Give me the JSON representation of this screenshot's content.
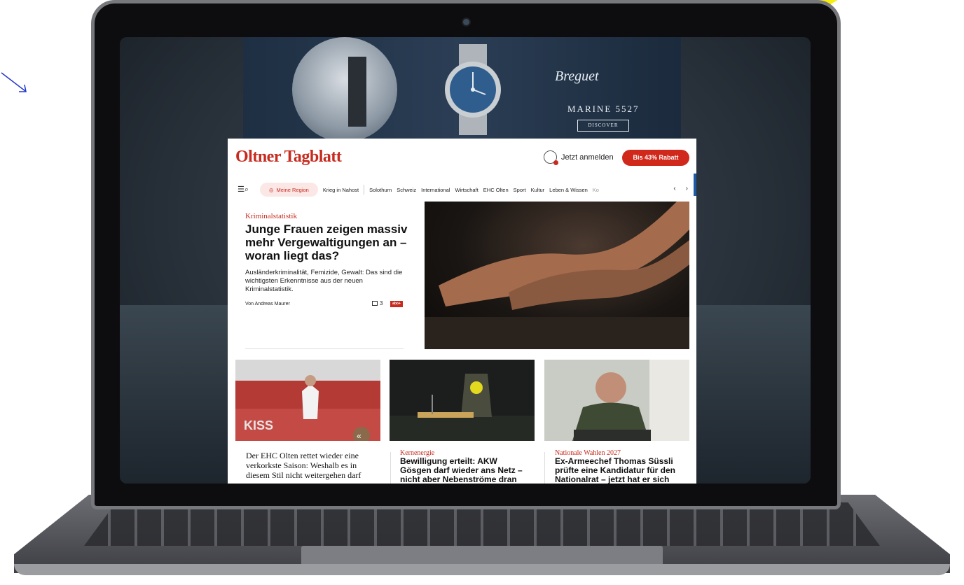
{
  "ad": {
    "brand": "Breguet",
    "model": "MARINE 5527",
    "cta": "DISCOVER"
  },
  "site": {
    "logo": "Oltner Tagblatt",
    "login_label": "Jetzt anmelden",
    "promo_label": "Bis 43% Rabatt"
  },
  "nav": {
    "menu_icon": "menu-search-icon",
    "region": "Meine Region",
    "items": [
      "Krieg in Nahost",
      "Solothurn",
      "Schweiz",
      "International",
      "Wirtschaft",
      "EHC Olten",
      "Sport",
      "Kultur",
      "Leben & Wissen",
      "Ko"
    ]
  },
  "lead": {
    "kicker": "Kriminalstatistik",
    "title": "Junge Frauen zeigen massiv mehr Vergewaltigungen an – woran liegt das?",
    "teaser": "Ausländerkriminalität, Femizide, Gewalt: Das sind die wichtigsten Erkenntnisse aus der neuen Kriminalstatistik.",
    "author": "Von Andreas Maurer",
    "comments": "3",
    "badge": "abo+"
  },
  "cards": [
    {
      "kicker": "",
      "title": "Der EHC Olten rettet wieder eine verkorkste Saison: Weshalb es in diesem Stil nicht weitergehen darf"
    },
    {
      "kicker": "Kernenergie",
      "title": "Bewilligung erteilt: AKW Gösgen darf wieder ans Netz – nicht aber Nebenströme dran"
    },
    {
      "kicker": "Nationale Wahlen 2027",
      "title": "Ex-Armeechef Thomas Süssli prüfte eine Kandidatur für den Nationalrat – jetzt hat er sich"
    }
  ],
  "colors": {
    "brand_red": "#c72b1f",
    "promo_red": "#d0281b",
    "accent_yellow": "#f6ef11"
  }
}
